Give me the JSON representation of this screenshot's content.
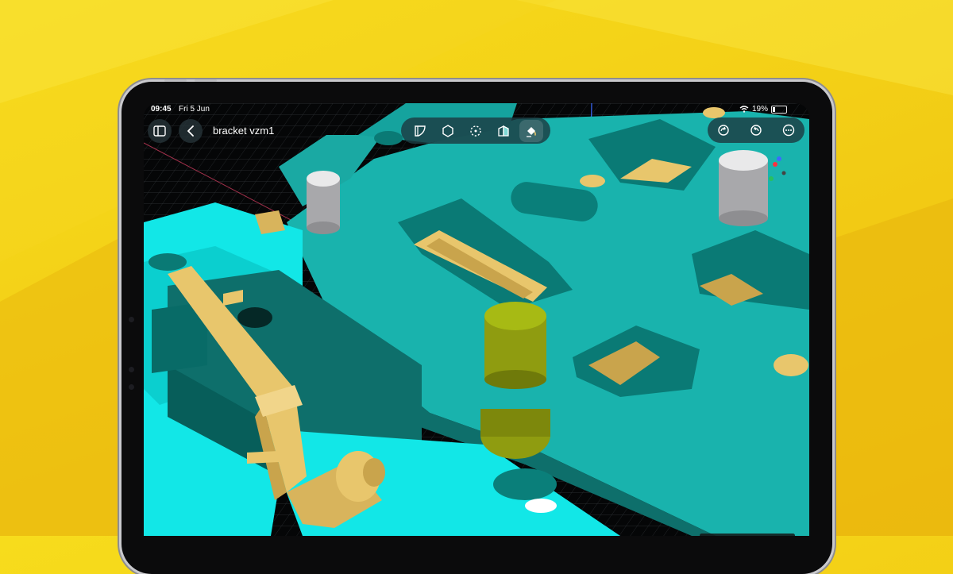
{
  "status_bar": {
    "time": "09:45",
    "date": "Fri 5 Jun",
    "battery": "19%",
    "battery_level": 0.19
  },
  "header": {
    "document_title": "bracket vzm1",
    "back_icon": "chevron-left-icon",
    "sidebar_icon": "sidebar-toggle-icon"
  },
  "toolbar": {
    "tools": [
      {
        "id": "sketch",
        "icon": "sketch-shape-icon"
      },
      {
        "id": "solid",
        "icon": "hexagon-solid-icon"
      },
      {
        "id": "select",
        "icon": "dashed-select-icon"
      },
      {
        "id": "section",
        "icon": "section-view-icon"
      },
      {
        "id": "appearance",
        "icon": "paint-bucket-icon",
        "active": true
      }
    ]
  },
  "actions": [
    {
      "id": "redo",
      "icon": "redo-icon"
    },
    {
      "id": "undo",
      "icon": "undo-icon"
    },
    {
      "id": "more",
      "icon": "more-ellipsis-icon"
    }
  ],
  "colors": {
    "background_yellow": "#f3cf16",
    "device_bezel": "#0b0b0c",
    "model_teal": "#19b3ad",
    "model_cyan": "#12e7e7",
    "model_dark_teal": "#0e6f6b",
    "brass": "#e8c66c",
    "olive_pin": "#9aaa12",
    "grey_pin": "#a8a8ab",
    "grid": "#2c3034"
  }
}
